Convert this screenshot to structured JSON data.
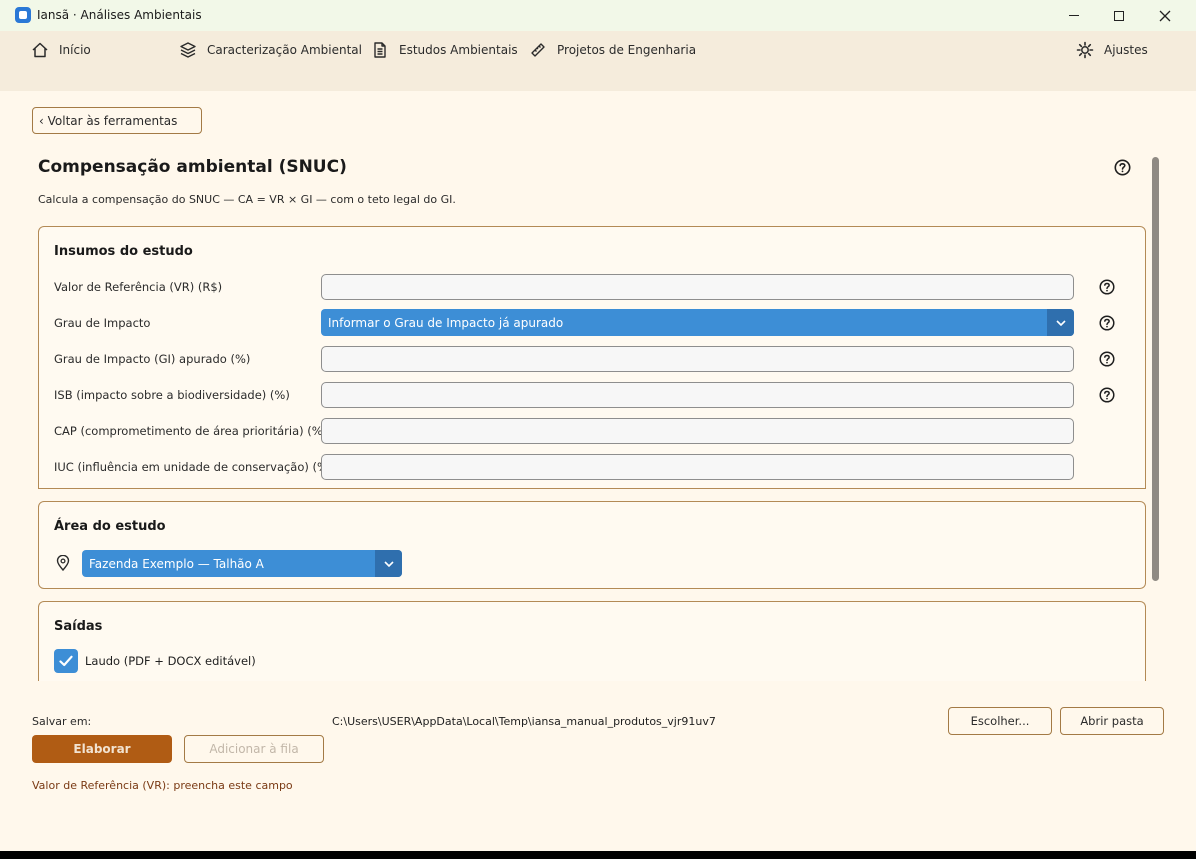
{
  "window": {
    "title": "Iansã · Análises Ambientais"
  },
  "nav": {
    "home": "Início",
    "caracterizacao": "Caracterização Ambiental",
    "estudos": "Estudos Ambientais",
    "projetos": "Projetos de Engenharia",
    "ajustes": "Ajustes"
  },
  "back_button": "‹ Voltar às ferramentas",
  "page": {
    "title": "Compensação ambiental (SNUC)",
    "description": "Calcula a compensação do SNUC — CA = VR × GI — com o teto legal do GI."
  },
  "inputs": {
    "title": "Insumos do estudo",
    "vr_label": "Valor de Referência (VR) (R$)",
    "vr_value": "",
    "grau_label": "Grau de Impacto",
    "grau_selected": "Informar o Grau de Impacto já apurado",
    "gi_label": "Grau de Impacto (GI) apurado (%)",
    "gi_value": "",
    "isb_label": "ISB (impacto sobre a biodiversidade) (%)",
    "isb_value": "",
    "cap_label": "CAP (comprometimento de área prioritária) (%)",
    "cap_value": "",
    "iuc_label": "IUC (influência em unidade de conservação) (%)",
    "iuc_value": ""
  },
  "area": {
    "title": "Área do estudo",
    "selected": "Fazenda Exemplo — Talhão A"
  },
  "saidas": {
    "title": "Saídas",
    "laudo_label": "Laudo (PDF + DOCX editável)",
    "laudo_checked": true
  },
  "bottom": {
    "save_label": "Salvar em:",
    "save_path": "C:\\Users\\USER\\AppData\\Local\\Temp\\iansa_manual_produtos_vjr91uv7",
    "choose": "Escolher...",
    "open_folder": "Abrir pasta",
    "elaborar": "Elaborar",
    "queue": "Adicionar à fila",
    "error": "Valor de Referência (VR): preencha este campo"
  },
  "colors": {
    "accent_blue": "#3d8ed6",
    "primary_button": "#b05c14",
    "border": "#b38a55",
    "background": "#fff8ec"
  }
}
